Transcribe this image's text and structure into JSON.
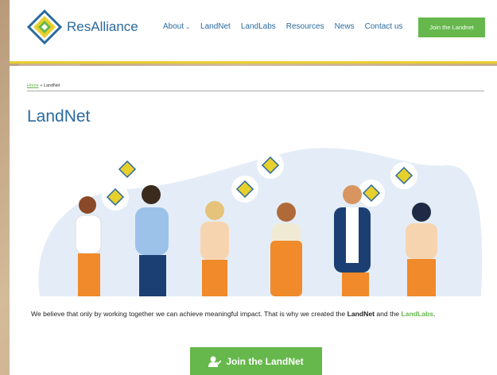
{
  "header": {
    "logo_text": "ResAlliance",
    "nav": [
      {
        "label": "About",
        "has_dropdown": true
      },
      {
        "label": "LandNet"
      },
      {
        "label": "LandLabs"
      },
      {
        "label": "Resources"
      },
      {
        "label": "News"
      },
      {
        "label": "Contact us"
      }
    ],
    "join_button": "Join the Landnet"
  },
  "breadcrumb": {
    "home": "Home",
    "separator": "»",
    "current": "LandNet"
  },
  "page_title": "LandNet",
  "tagline": {
    "prefix": "We believe that only by working together we can achieve meaningful impact. That is why we created the ",
    "landnet": "LandNet",
    "middle": " and the ",
    "landlabs": "LandLabs",
    "suffix": "."
  },
  "cta_button": "Join the LandNet",
  "colors": {
    "brand_blue": "#2a6a9e",
    "brand_green": "#66b84c",
    "accent_yellow": "#e7cf2e"
  },
  "icons": [
    "resalliance-logo-icon",
    "chevron-down-icon",
    "user-check-icon"
  ]
}
